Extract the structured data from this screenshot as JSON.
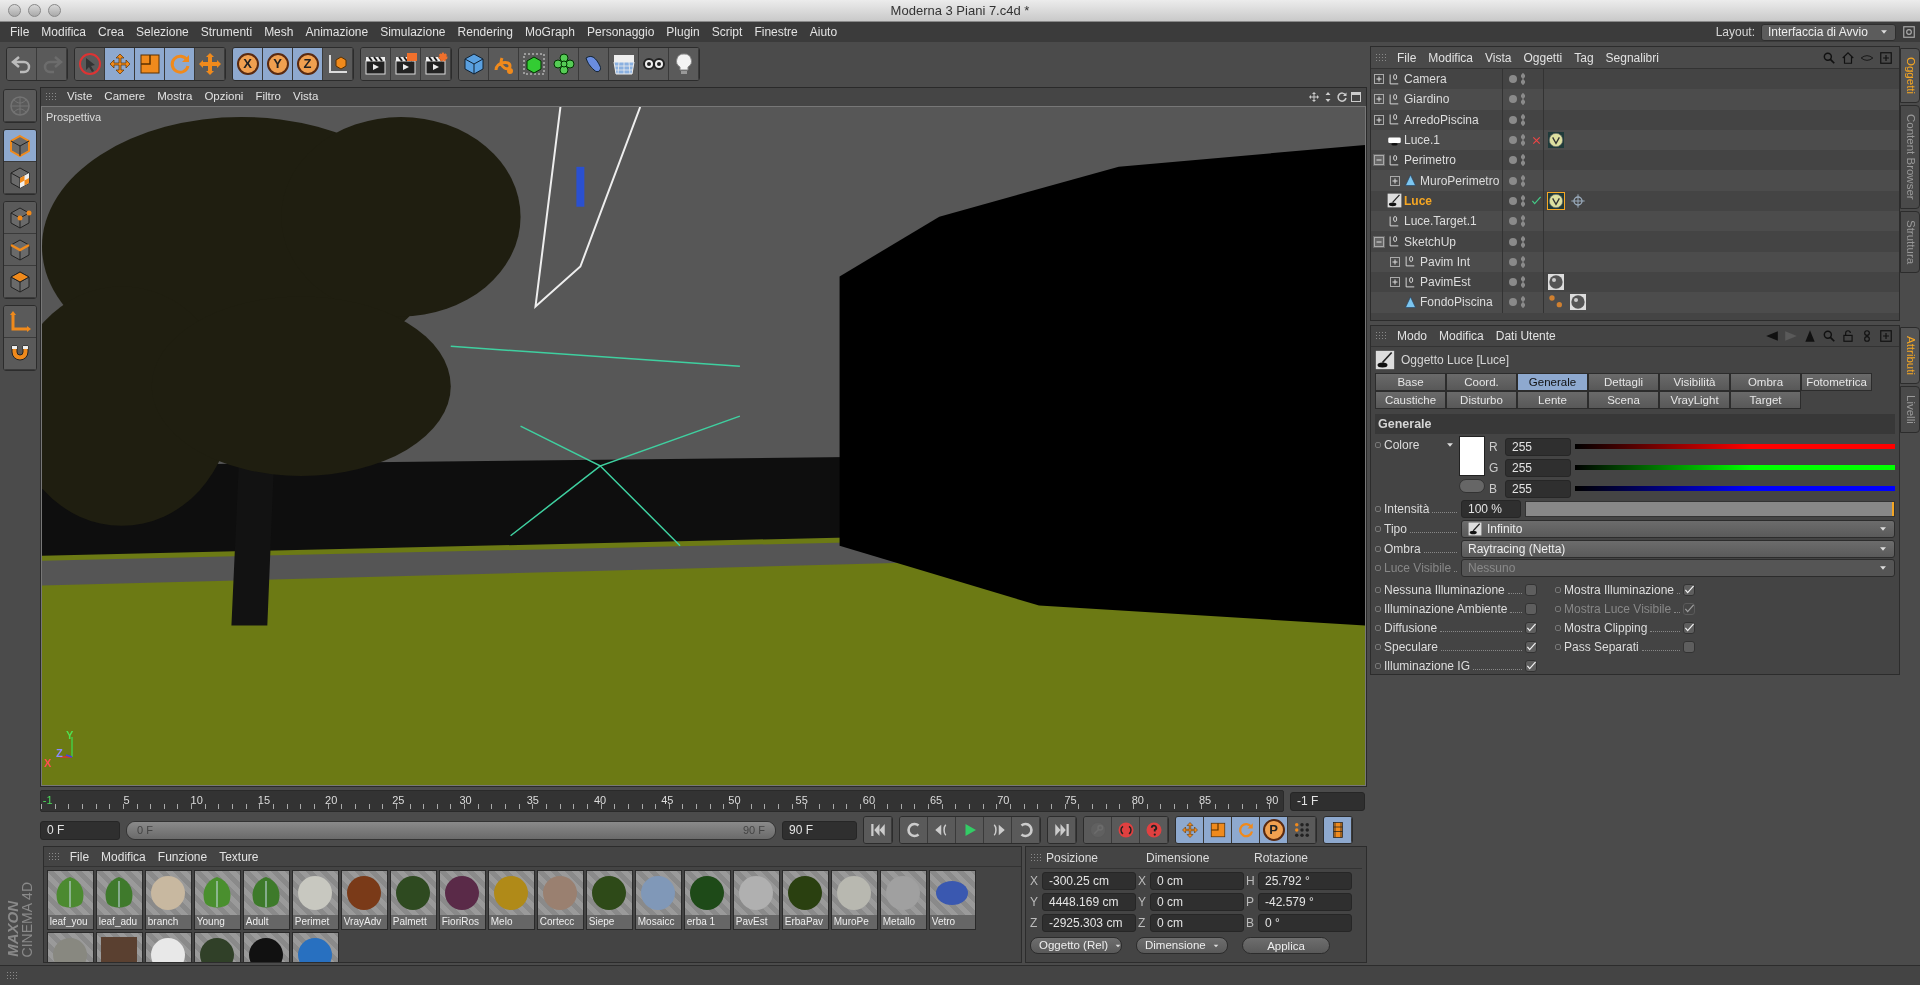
{
  "window": {
    "title": "Moderna 3 Piani 7.c4d *"
  },
  "menu_bar": [
    "File",
    "Modifica",
    "Crea",
    "Selezione",
    "Strumenti",
    "Mesh",
    "Animazione",
    "Simulazione",
    "Rendering",
    "MoGraph",
    "Personaggio",
    "Plugin",
    "Script",
    "Finestre",
    "Aiuto"
  ],
  "layout": {
    "label": "Layout:",
    "value": "Interfaccia di Avvio"
  },
  "toolbar": [
    {
      "items": [
        {
          "kind": "undo",
          "active": false,
          "disabled": false
        },
        {
          "kind": "redo",
          "active": false,
          "disabled": true
        }
      ]
    },
    {
      "items": [
        {
          "kind": "select",
          "active": false,
          "disabled": false
        },
        {
          "kind": "move",
          "active": true,
          "disabled": false
        },
        {
          "kind": "scale",
          "active": true,
          "disabled": false
        },
        {
          "kind": "rotate",
          "active": true,
          "disabled": false
        },
        {
          "kind": "recent-tool",
          "active": false,
          "disabled": false
        }
      ]
    },
    {
      "items": [
        {
          "kind": "axis",
          "label": "X",
          "active": true
        },
        {
          "kind": "axis",
          "label": "Y",
          "active": true
        },
        {
          "kind": "axis",
          "label": "Z",
          "active": true
        },
        {
          "kind": "coord-system",
          "active": false
        }
      ]
    },
    {
      "items": [
        {
          "kind": "render-view",
          "active": false,
          "disabled": false
        },
        {
          "kind": "render-picture",
          "active": false,
          "disabled": false
        },
        {
          "kind": "render-settings",
          "active": false,
          "disabled": false
        }
      ]
    },
    {
      "items": [
        {
          "kind": "cube",
          "active": false,
          "disabled": false
        },
        {
          "kind": "spline",
          "active": false,
          "disabled": false
        },
        {
          "kind": "nurbs",
          "active": false,
          "disabled": false
        },
        {
          "kind": "array",
          "active": false,
          "disabled": false
        },
        {
          "kind": "deformer",
          "active": false,
          "disabled": false
        },
        {
          "kind": "floor",
          "active": false,
          "disabled": false
        },
        {
          "kind": "camera",
          "active": false,
          "disabled": false
        },
        {
          "kind": "light",
          "active": false,
          "disabled": false
        }
      ]
    }
  ],
  "mode_toolbar": [
    {
      "items": [
        {
          "kind": "globe",
          "active": false,
          "disabled": true
        }
      ]
    },
    {
      "items": [
        {
          "kind": "model",
          "active": true,
          "disabled": false
        },
        {
          "kind": "texture",
          "active": false,
          "disabled": false
        }
      ]
    },
    {
      "items": [
        {
          "kind": "points",
          "active": false,
          "disabled": false
        },
        {
          "kind": "edges",
          "active": false,
          "disabled": false
        },
        {
          "kind": "polygons",
          "active": false,
          "disabled": false
        }
      ]
    },
    {
      "items": [
        {
          "kind": "axis-mode",
          "active": false,
          "disabled": false
        },
        {
          "kind": "magnet",
          "active": false,
          "disabled": false
        }
      ]
    }
  ],
  "viewport": {
    "menu": [
      "Viste",
      "Camere",
      "Mostra",
      "Opzioni",
      "Filtro",
      "Vista"
    ],
    "view_name": "Prospettiva",
    "axis_labels": [
      "X",
      "Z",
      "Y"
    ]
  },
  "timeline": {
    "ticks": [
      {
        "label": "-1",
        "current": true
      },
      {
        "label": "5",
        "current": false
      },
      {
        "label": "10",
        "current": false
      },
      {
        "label": "15",
        "current": false
      },
      {
        "label": "20",
        "current": false
      },
      {
        "label": "25",
        "current": false
      },
      {
        "label": "30",
        "current": false
      },
      {
        "label": "35",
        "current": false
      },
      {
        "label": "40",
        "current": false
      },
      {
        "label": "45",
        "current": false
      },
      {
        "label": "50",
        "current": false
      },
      {
        "label": "55",
        "current": false
      },
      {
        "label": "60",
        "current": false
      },
      {
        "label": "65",
        "current": false
      },
      {
        "label": "70",
        "current": false
      },
      {
        "label": "75",
        "current": false
      },
      {
        "label": "80",
        "current": false
      },
      {
        "label": "85",
        "current": false
      },
      {
        "label": "90",
        "current": false
      }
    ],
    "current_field": "-1 F",
    "start_field": "0 F",
    "range": {
      "start": "0 F",
      "end": "90 F",
      "level": 1
    },
    "end_field": "90 F",
    "transport": [
      {
        "items": [
          {
            "kind": "go-start",
            "active": false,
            "disabled": false
          }
        ]
      },
      {
        "items": [
          {
            "kind": "loop-back",
            "active": false,
            "disabled": false
          },
          {
            "kind": "prev-key",
            "active": false,
            "disabled": false
          },
          {
            "kind": "play",
            "active": false,
            "disabled": false
          },
          {
            "kind": "next-key",
            "active": false,
            "disabled": false
          },
          {
            "kind": "loop-forward",
            "active": false,
            "disabled": false
          }
        ]
      },
      {
        "items": [
          {
            "kind": "go-end",
            "active": false,
            "disabled": false
          }
        ]
      },
      {
        "items": [
          {
            "kind": "key",
            "active": false,
            "disabled": true
          },
          {
            "kind": "autokey",
            "active": false,
            "disabled": false
          },
          {
            "kind": "help",
            "active": false,
            "disabled": false
          }
        ]
      },
      {
        "items": [
          {
            "kind": "move",
            "active": true,
            "disabled": false
          },
          {
            "kind": "scale",
            "active": true,
            "disabled": false
          },
          {
            "kind": "rotate",
            "active": true,
            "disabled": false
          },
          {
            "kind": "axis",
            "label": "P",
            "active": true
          },
          {
            "kind": "dots",
            "active": false,
            "disabled": false
          }
        ]
      },
      {
        "items": [
          {
            "kind": "film",
            "active": true,
            "disabled": false
          }
        ]
      }
    ]
  },
  "brand": {
    "company": "MAXON",
    "product": "CINEMA 4D"
  },
  "material_manager": {
    "menu": [
      "File",
      "Modifica",
      "Funzione",
      "Texture"
    ],
    "materials": [
      {
        "name": "leaf_you",
        "kind": "leaf",
        "color": "#4c8a30"
      },
      {
        "name": "leaf_adu",
        "kind": "leaf",
        "color": "#3f7a2c"
      },
      {
        "name": "branch",
        "kind": "sphere",
        "color": "#c8b8a0"
      },
      {
        "name": "Young",
        "kind": "leaf",
        "color": "#4a8f2e"
      },
      {
        "name": "Adult",
        "kind": "leaf",
        "color": "#3d7a2a"
      },
      {
        "name": "Perimet",
        "kind": "sphere",
        "color": "#c8c8c0"
      },
      {
        "name": "VrayAdv",
        "kind": "sphere",
        "color": "#7a3a18"
      },
      {
        "name": "Palmett",
        "kind": "sphere",
        "color": "#2e4a20"
      },
      {
        "name": "FioriRos",
        "kind": "sphere",
        "color": "#5a2a48"
      },
      {
        "name": "Melo",
        "kind": "sphere",
        "color": "#b08a18"
      },
      {
        "name": "Cortecc",
        "kind": "sphere",
        "color": "#9a8070"
      },
      {
        "name": "Siepe",
        "kind": "sphere",
        "color": "#2e4a18"
      },
      {
        "name": "Mosaicc",
        "kind": "sphere",
        "color": "#8098b8"
      },
      {
        "name": "erba 1",
        "kind": "sphere",
        "color": "#1e4a18"
      },
      {
        "name": "PavEst",
        "kind": "sphere",
        "color": "#b0b0b0"
      },
      {
        "name": "ErbaPav",
        "kind": "sphere",
        "color": "#2a4010"
      },
      {
        "name": "MuroPe",
        "kind": "sphere",
        "color": "#b8b8b0"
      },
      {
        "name": "Metallo",
        "kind": "sphere",
        "color": "#a0a0a0"
      },
      {
        "name": "Vetro",
        "kind": "glass",
        "color": "#3a58b0"
      },
      {
        "kind": "sphere",
        "color": "#888880"
      },
      {
        "kind": "flat",
        "color": "#5a4030"
      },
      {
        "kind": "sphere",
        "color": "#e8e8e8"
      },
      {
        "kind": "sphere",
        "color": "#304028"
      },
      {
        "kind": "sphere",
        "color": "#111111"
      },
      {
        "kind": "sphere",
        "color": "#2870c0"
      }
    ]
  },
  "coordinates": {
    "headers": [
      "Posizione",
      "Dimensione",
      "Rotazione"
    ],
    "rows": [
      {
        "cells": [
          {
            "axis": "X",
            "value": "-300.25 cm"
          },
          {
            "axis": "X",
            "value": "0 cm"
          },
          {
            "axis": "H",
            "value": "25.792 °"
          }
        ]
      },
      {
        "cells": [
          {
            "axis": "Y",
            "value": "4448.169 cm"
          },
          {
            "axis": "Y",
            "value": "0 cm"
          },
          {
            "axis": "P",
            "value": "-42.579 °"
          }
        ]
      },
      {
        "cells": [
          {
            "axis": "Z",
            "value": "-2925.303 cm"
          },
          {
            "axis": "Z",
            "value": "0 cm"
          },
          {
            "axis": "B",
            "value": "0 °"
          }
        ]
      }
    ],
    "dropdowns": [
      "Oggetto (Rel)",
      "Dimensione"
    ],
    "apply": "Applica"
  },
  "object_manager": {
    "menu": [
      "File",
      "Modifica",
      "Vista",
      "Oggetti",
      "Tag",
      "Segnalibri"
    ],
    "objects": [
      {
        "name": "Camera",
        "kind": "null",
        "expandable": true,
        "expanded": false,
        "selected": false
      },
      {
        "name": "Giardino",
        "kind": "null",
        "expandable": true,
        "expanded": false,
        "selected": false
      },
      {
        "name": "ArredoPiscina",
        "kind": "null",
        "expandable": true,
        "expanded": false,
        "selected": false
      },
      {
        "name": "Luce.1",
        "kind": "area-light",
        "expandable": false,
        "selected": false,
        "enabled": false,
        "tags": [
          {
            "kind": "vray",
            "selected": false
          }
        ]
      },
      {
        "name": "Perimetro",
        "kind": "null",
        "expandable": true,
        "expanded": true,
        "selected": false,
        "children": [
          {
            "name": "MuroPerimetro",
            "kind": "polygon",
            "expandable": true,
            "expanded": false,
            "selected": false
          }
        ]
      },
      {
        "name": "Luce",
        "kind": "infinite-light",
        "expandable": false,
        "selected": true,
        "enabled": true,
        "tags": [
          {
            "kind": "vray",
            "selected": true
          },
          {
            "kind": "target",
            "selected": false
          }
        ]
      },
      {
        "name": "Luce.Target.1",
        "kind": "null",
        "expandable": false,
        "selected": false
      },
      {
        "name": "SketchUp",
        "kind": "null",
        "expandable": true,
        "expanded": true,
        "selected": false,
        "children": [
          {
            "name": "Pavim Int",
            "kind": "null",
            "expandable": true,
            "expanded": false,
            "selected": false
          },
          {
            "name": "PavimEst",
            "kind": "null",
            "expandable": true,
            "expanded": false,
            "selected": false,
            "tags": [
              {
                "kind": "material",
                "selected": false
              }
            ]
          },
          {
            "name": "FondoPiscina",
            "kind": "polygon",
            "expandable": false,
            "selected": false,
            "tags": [
              {
                "kind": "points",
                "selected": false
              },
              {
                "kind": "material",
                "selected": false
              }
            ]
          }
        ]
      }
    ]
  },
  "side_tabs_top": [
    {
      "label": "Oggetti",
      "selected": true
    },
    {
      "label": "Content Browser",
      "selected": false
    },
    {
      "label": "Struttura",
      "selected": false
    }
  ],
  "attributes": {
    "menu": [
      "Modo",
      "Modifica",
      "Dati Utente"
    ],
    "title": "Oggetto Luce [Luce]",
    "tabs": [
      {
        "label": "Base",
        "selected": false
      },
      {
        "label": "Coord.",
        "selected": false
      },
      {
        "label": "Generale",
        "selected": true
      },
      {
        "label": "Dettagli",
        "selected": false
      },
      {
        "label": "Visibilità",
        "selected": false
      },
      {
        "label": "Ombra",
        "selected": false
      },
      {
        "label": "Fotometrica",
        "selected": false
      },
      {
        "label": "Caustiche",
        "selected": false
      },
      {
        "label": "Disturbo",
        "selected": false
      },
      {
        "label": "Lente",
        "selected": false
      },
      {
        "label": "Scena",
        "selected": false
      },
      {
        "label": "VrayLight",
        "selected": false
      },
      {
        "label": "Target",
        "selected": false
      }
    ],
    "section": "Generale",
    "color": {
      "label": "Colore",
      "preview": {
        "color": "#ffffff"
      },
      "channels": [
        {
          "label": "R",
          "value": "255",
          "level": 1,
          "color": "#ff0000"
        },
        {
          "label": "G",
          "value": "255",
          "level": 1,
          "color": "#00ff00"
        },
        {
          "label": "B",
          "value": "255",
          "level": 1,
          "color": "#0000ff"
        }
      ]
    },
    "intensity": {
      "label": "Intensità",
      "value": "100 %",
      "level": 1
    },
    "dropdowns": [
      {
        "label": "Tipo",
        "value": "Infinito",
        "kind": "with-icon",
        "disabled": false
      },
      {
        "label": "Ombra",
        "value": "Raytracing (Netta)",
        "kind": "plain",
        "disabled": false
      },
      {
        "label": "Luce Visibile",
        "value": "Nessuno",
        "kind": "plain",
        "disabled": true
      }
    ],
    "checks_left": [
      {
        "label": "Nessuna Illuminazione",
        "checked": false,
        "disabled": false
      },
      {
        "label": "Illuminazione Ambiente",
        "checked": false,
        "disabled": false
      },
      {
        "label": "Diffusione",
        "checked": true,
        "disabled": false
      },
      {
        "label": "Speculare",
        "checked": true,
        "disabled": false
      },
      {
        "label": "Illuminazione IG",
        "checked": true,
        "disabled": false
      }
    ],
    "checks_right": [
      {
        "label": "Mostra Illuminazione",
        "checked": true,
        "disabled": false
      },
      {
        "label": "Mostra Luce Visibile",
        "checked": true,
        "disabled": true
      },
      {
        "label": "Mostra Clipping",
        "checked": true,
        "disabled": false
      },
      {
        "label": "Pass Separati",
        "checked": false,
        "disabled": false
      }
    ]
  },
  "side_tabs_bottom": [
    {
      "label": "Attributi",
      "selected": true
    },
    {
      "label": "Livelli",
      "selected": false
    }
  ]
}
